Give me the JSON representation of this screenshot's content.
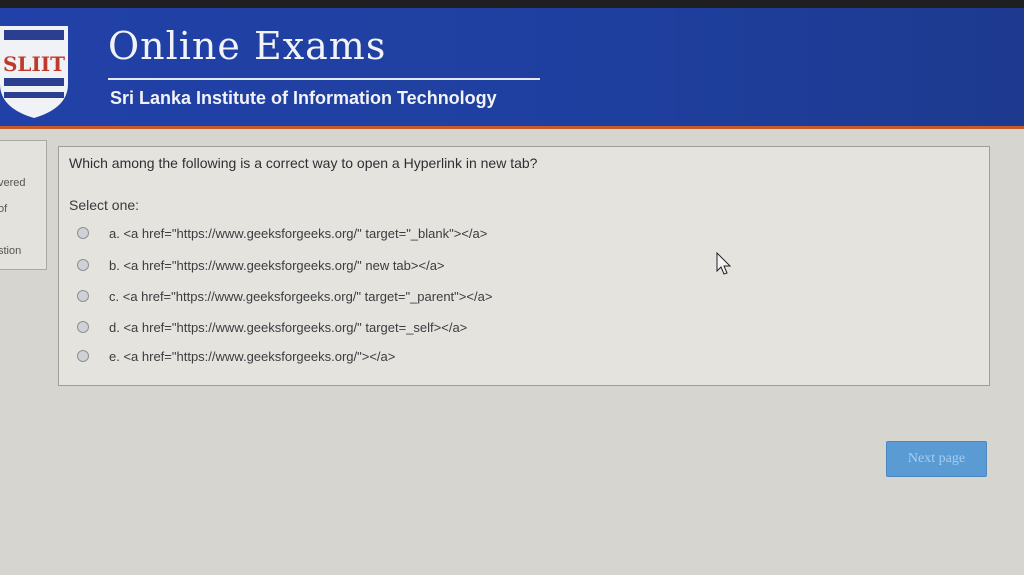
{
  "header": {
    "logo_text": "SLIIT",
    "title": "Online Exams",
    "subtitle": "Sri Lanka Institute of Information Technology"
  },
  "sidebar": {
    "line1": "vered",
    "line2": "of",
    "line3": "stion"
  },
  "question": {
    "text": "Which among the following is a correct way to open a Hyperlink in new tab?",
    "prompt": "Select one:",
    "options": [
      "a. <a href=\"https://www.geeksforgeeks.org/\" target=\"_blank\"></a>",
      "b. <a href=\"https://www.geeksforgeeks.org/\" new tab></a>",
      "c. <a href=\"https://www.geeksforgeeks.org/\" target=\"_parent\"></a>",
      "d. <a href=\"https://www.geeksforgeeks.org/\" target=_self></a>",
      "e. <a href=\"https://www.geeksforgeeks.org/\"></a>"
    ]
  },
  "footer": {
    "next_label": "Next page"
  },
  "colors": {
    "header_bg": "#2241a8",
    "accent_line": "#c65a2a",
    "button_bg": "#5a9bd4"
  }
}
